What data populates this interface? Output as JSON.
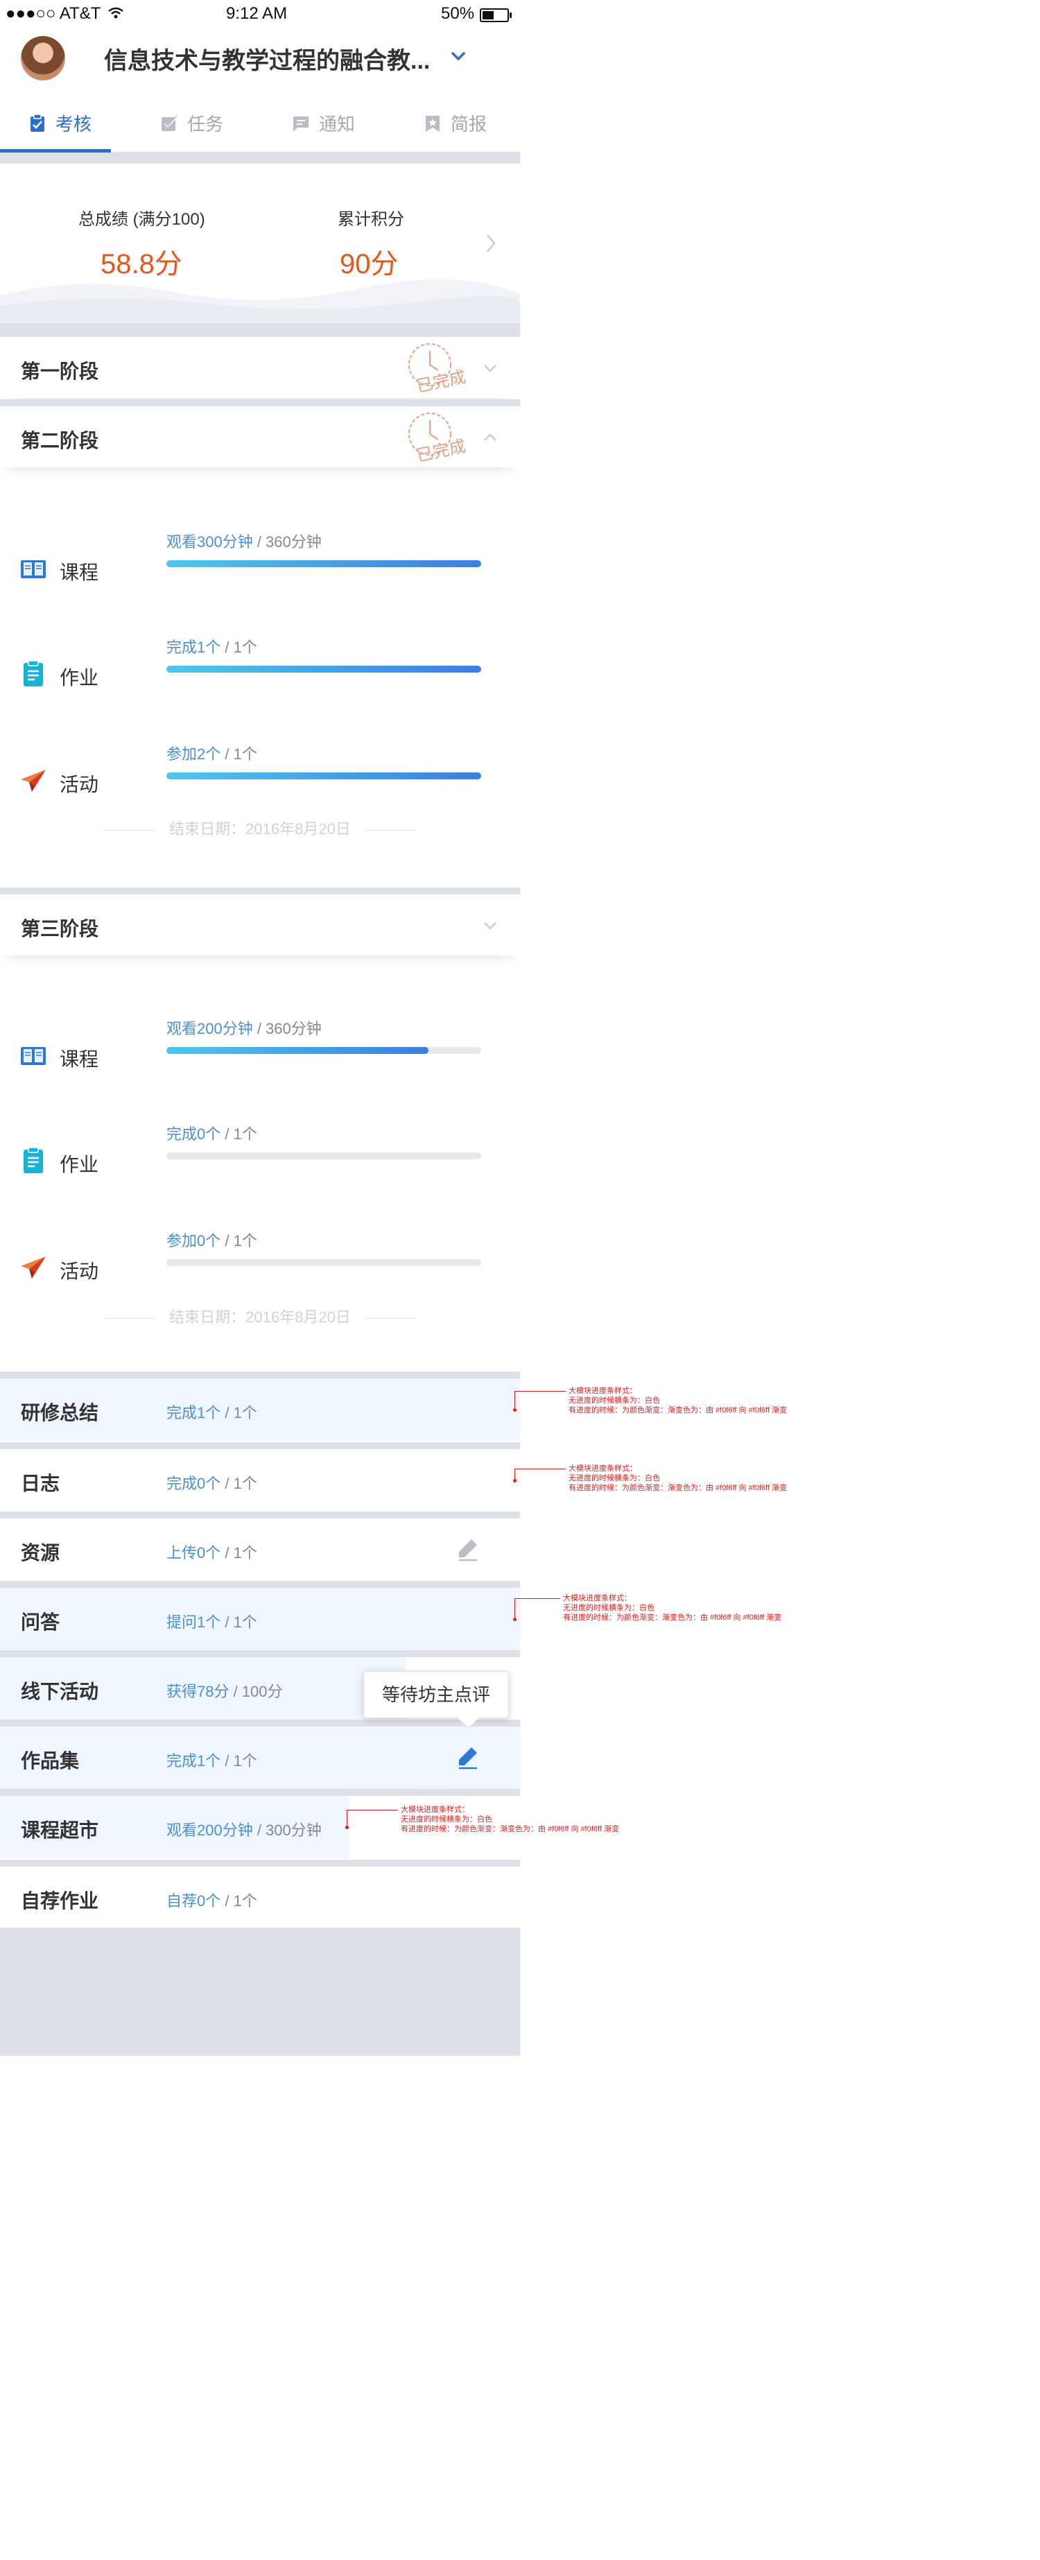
{
  "status_bar": {
    "carrier": "●●●○○ AT&T",
    "time": "9:12 AM",
    "battery": "50%",
    "battery_level": 0.5
  },
  "header": {
    "title": "信息技术与教学过程的融合教..."
  },
  "tabs": [
    {
      "label": "考核",
      "icon": "clipboard-icon",
      "active": true
    },
    {
      "label": "任务",
      "icon": "task-check-icon",
      "active": false
    },
    {
      "label": "通知",
      "icon": "message-icon",
      "active": false
    },
    {
      "label": "简报",
      "icon": "bookmark-star-icon",
      "active": false
    }
  ],
  "score": {
    "total_label": "总成绩 (满分100)",
    "total_value": "58.8",
    "total_unit": "分",
    "points_label": "累计积分",
    "points_value": "90",
    "points_unit": "分"
  },
  "stages": [
    {
      "title": "第一阶段",
      "stamp": "已完成",
      "expanded": false
    },
    {
      "title": "第二阶段",
      "stamp": "已完成",
      "expanded": true,
      "items": [
        {
          "label": "课程",
          "icon": "book-icon",
          "progress_main": "观看300分钟",
          "progress_total": " / 360分钟",
          "fraction": 1.0
        },
        {
          "label": "作业",
          "icon": "document-icon",
          "progress_main": "完成1个",
          "progress_total": " / 1个",
          "fraction": 1.0
        },
        {
          "label": "活动",
          "icon": "paper-plane-icon",
          "progress_main": "参加2个",
          "progress_total": " / 1个",
          "fraction": 1.0
        }
      ],
      "end_date": "结束日期：2016年8月20日"
    },
    {
      "title": "第三阶段",
      "expanded": true,
      "items": [
        {
          "label": "课程",
          "icon": "book-icon",
          "progress_main": "观看200分钟",
          "progress_total": " / 360分钟",
          "fraction": 0.833
        },
        {
          "label": "作业",
          "icon": "document-icon",
          "progress_main": "完成0个",
          "progress_total": " / 1个",
          "fraction": 0
        },
        {
          "label": "活动",
          "icon": "paper-plane-icon",
          "progress_main": "参加0个",
          "progress_total": " / 1个",
          "fraction": 0
        }
      ],
      "end_date": "结束日期：2016年8月20日"
    }
  ],
  "modules": [
    {
      "title": "研修总结",
      "progress_main": "完成1个",
      "progress_total": " / 1个",
      "fraction": 1.0
    },
    {
      "title": "日志",
      "progress_main": "完成0个",
      "progress_total": " / 1个",
      "fraction": 0
    },
    {
      "title": "资源",
      "progress_main": "上传0个",
      "progress_total": " / 1个",
      "fraction": 0,
      "edit_icon": true,
      "edit_active": false
    },
    {
      "title": "问答",
      "progress_main": "提问1个",
      "progress_total": " / 1个",
      "fraction": 1.0
    },
    {
      "title": "线下活动",
      "progress_main": "获得78分",
      "progress_total": " / 100分",
      "fraction": 0.78
    },
    {
      "title": "作品集",
      "progress_main": "完成1个",
      "progress_total": " / 1个",
      "fraction": 1.0,
      "edit_icon": true,
      "edit_active": true
    },
    {
      "title": "课程超市",
      "progress_main": "观看200分钟",
      "progress_total": " / 300分钟",
      "fraction": 0.67
    },
    {
      "title": "自荐作业",
      "progress_main": "自荐0个",
      "progress_total": " / 1个",
      "fraction": 0
    }
  ],
  "tooltip": "等待坊主点评",
  "annotations": [
    [
      "大模块进度条样式：",
      "无进度的时候横条为：白色",
      "有进度的时候：为颜色渐变：渐变色为：由 #f0f6ff 向 #f0f6ff 渐变"
    ],
    [
      "大模块进度条样式：",
      "无进度的时候横条为：白色",
      "有进度的时候：为颜色渐变：渐变色为：由 #f0f6ff 向 #f0f6ff 渐变"
    ],
    [
      "大模块进度条样式：",
      "无进度的时候横条为：白色",
      "有进度的时候：为颜色渐变：渐变色为：由 #f0f6ff 向 #f0f6ff 渐变"
    ],
    [
      "大模块进度条样式：",
      "无进度的时候横条为：白色",
      "有进度的时候：为颜色渐变：渐变色为：由 #f0f6ff 向 #f0f6ff 渐变"
    ]
  ],
  "colors": {
    "accent": "#2d6fc6",
    "score": "#e2581e",
    "progress_start": "#4ec7ee",
    "progress_end": "#3b7fe0",
    "module_fill": "#f0f6ff",
    "stamp": "#e8a080",
    "annotation": "#e02020"
  }
}
